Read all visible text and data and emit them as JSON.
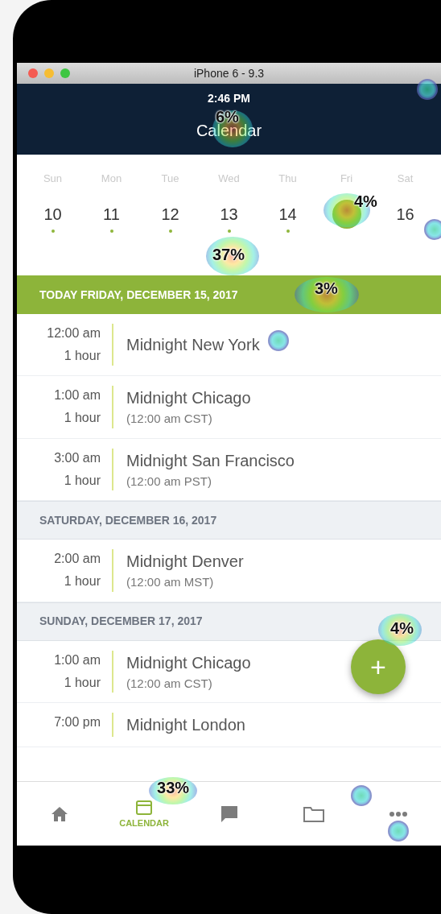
{
  "simulator": {
    "title": "iPhone 6 - 9.3"
  },
  "navbar": {
    "time": "2:46 PM",
    "title": "Calendar",
    "title_heat": "6%",
    "hot": true
  },
  "week": [
    {
      "weekday": "Sun",
      "day": "10",
      "has_events": true,
      "selected": false
    },
    {
      "weekday": "Mon",
      "day": "11",
      "has_events": true,
      "selected": false
    },
    {
      "weekday": "Tue",
      "day": "12",
      "has_events": true,
      "selected": false
    },
    {
      "weekday": "Wed",
      "day": "13",
      "has_events": true,
      "selected": false,
      "heat": "37%"
    },
    {
      "weekday": "Thu",
      "day": "14",
      "has_events": true,
      "selected": false
    },
    {
      "weekday": "Fri",
      "has_events": false,
      "selected": true,
      "heat": "4%"
    },
    {
      "weekday": "Sat",
      "day": "16",
      "has_events": false,
      "selected": false,
      "hot": true
    }
  ],
  "sections": [
    {
      "kind": "today",
      "heading": "TODAY FRIDAY, DECEMBER 15, 2017",
      "heat": "3%",
      "events": [
        {
          "time": "12:00 am",
          "duration": "1 hour",
          "title": "Midnight New York",
          "hot": true
        },
        {
          "time": "1:00 am",
          "duration": "1 hour",
          "title": "Midnight Chicago",
          "subtitle": "(12:00 am CST)"
        },
        {
          "time": "3:00 am",
          "duration": "1 hour",
          "title": "Midnight San Francisco",
          "subtitle": "(12:00 am PST)"
        }
      ]
    },
    {
      "kind": "day",
      "heading": "SATURDAY, DECEMBER 16, 2017",
      "events": [
        {
          "time": "2:00 am",
          "duration": "1 hour",
          "title": "Midnight Denver",
          "subtitle": "(12:00 am MST)"
        }
      ]
    },
    {
      "kind": "day",
      "heading": "SUNDAY, DECEMBER 17, 2017",
      "events": [
        {
          "time": "1:00 am",
          "duration": "1 hour",
          "title": "Midnight Chicago",
          "subtitle": "(12:00 am CST)"
        },
        {
          "time": "7:00 pm",
          "title": "Midnight London"
        }
      ]
    }
  ],
  "fab": {
    "label": "+",
    "heat": "4%"
  },
  "tabs": [
    {
      "kind": "home",
      "selected": false
    },
    {
      "kind": "calendar",
      "label": "CALENDAR",
      "selected": true,
      "heat": "33%"
    },
    {
      "kind": "chat",
      "selected": false
    },
    {
      "kind": "folder",
      "selected": false,
      "hot": true
    },
    {
      "kind": "more",
      "selected": false,
      "hot": true
    }
  ]
}
